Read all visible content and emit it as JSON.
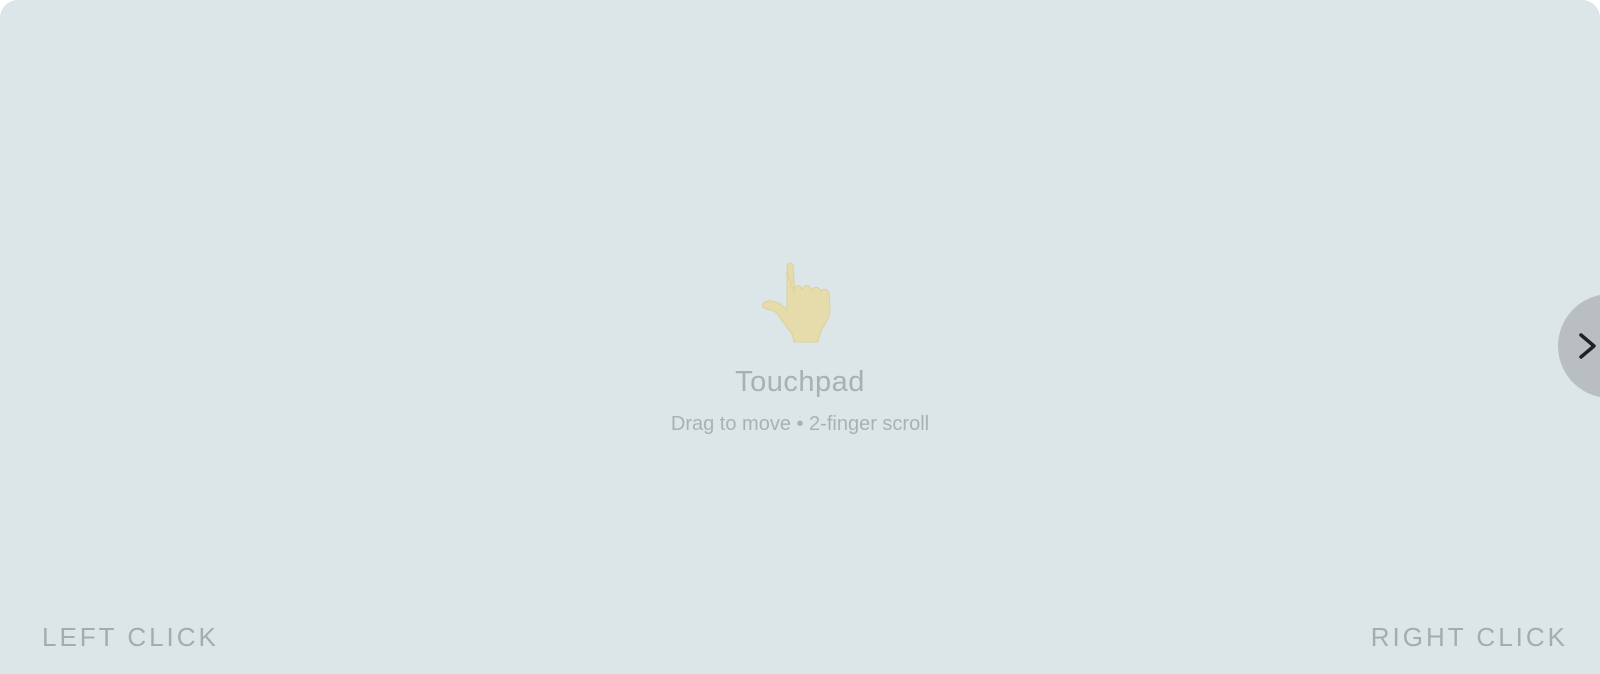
{
  "touchpad": {
    "title": "Touchpad",
    "hint": "Drag to move • 2-finger scroll",
    "left_click_label": "LEFT CLICK",
    "right_click_label": "RIGHT CLICK",
    "hand_icon": "pointing-hand-icon",
    "toggle_icon": "chevron-right-icon"
  },
  "colors": {
    "surface": "#dce5e8",
    "label_text": "#a4acaf",
    "hand": "#e6dbab",
    "toggle_bg": "#b8bec1",
    "chevron": "#1e2224"
  }
}
